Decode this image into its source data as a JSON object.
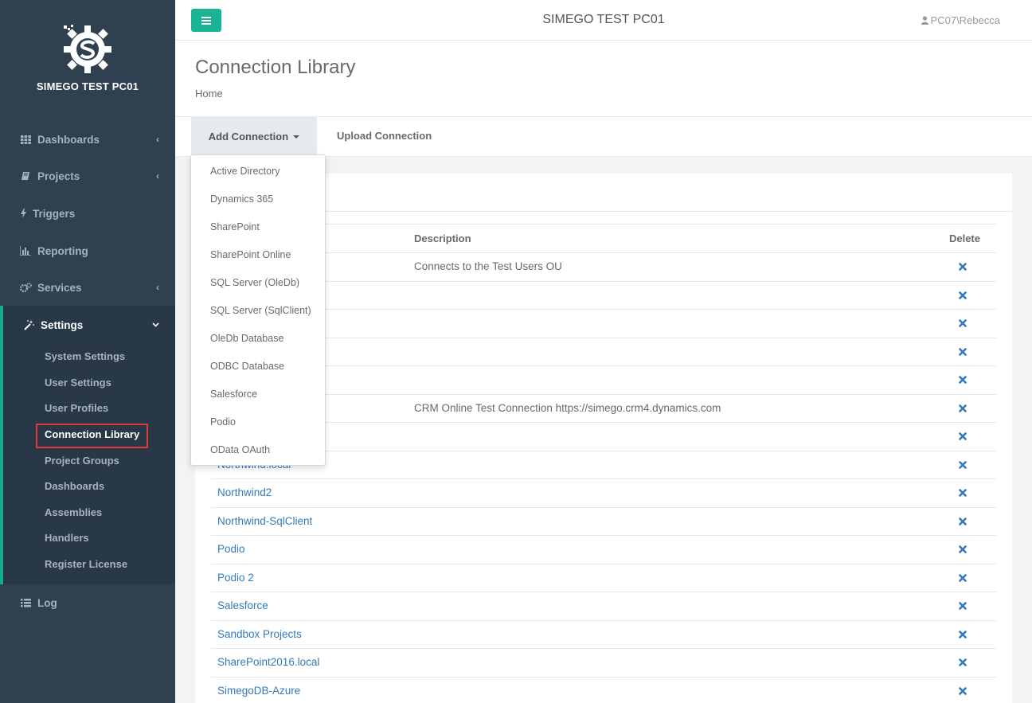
{
  "brand": {
    "name": "SIMEGO TEST PC01"
  },
  "topbar": {
    "title": "SIMEGO TEST PC01",
    "user": "PC07\\Rebecca"
  },
  "sidebar": {
    "items": [
      {
        "label": "Dashboards",
        "icon": "th-icon",
        "has_chevron": true
      },
      {
        "label": "Projects",
        "icon": "book-icon",
        "has_chevron": true
      },
      {
        "label": "Triggers",
        "icon": "bolt-icon",
        "has_chevron": false
      },
      {
        "label": "Reporting",
        "icon": "bar-chart-icon",
        "has_chevron": false
      },
      {
        "label": "Services",
        "icon": "cogs-icon",
        "has_chevron": true
      }
    ],
    "settings": {
      "label": "Settings",
      "icon": "magic-wand-icon",
      "sub_items": [
        "System Settings",
        "User Settings",
        "User Profiles",
        "Connection Library",
        "Project Groups",
        "Dashboards",
        "Assemblies",
        "Handlers",
        "Register License"
      ],
      "active": "Connection Library"
    },
    "log": {
      "label": "Log",
      "icon": "list-icon"
    }
  },
  "page": {
    "title": "Connection Library",
    "breadcrumb": "Home"
  },
  "toolbar": {
    "add_label": "Add Connection",
    "upload_label": "Upload Connection"
  },
  "dropdown": {
    "items": [
      "Active Directory",
      "Dynamics 365",
      "SharePoint",
      "SharePoint Online",
      "SQL Server (OleDb)",
      "SQL Server (SqlClient)",
      "OleDb Database",
      "ODBC Database",
      "Salesforce",
      "Podio",
      "OData OAuth"
    ]
  },
  "table": {
    "headers": {
      "description": "Description",
      "delete": "Delete"
    },
    "rows": [
      {
        "name": "",
        "description": "Connects to the Test Users OU"
      },
      {
        "name": "",
        "description": ""
      },
      {
        "name": "",
        "description": ""
      },
      {
        "name": "",
        "description": ""
      },
      {
        "name": "",
        "description": ""
      },
      {
        "name": "",
        "description": "CRM Online Test Connection https://simego.crm4.dynamics.com"
      },
      {
        "name": "",
        "description": ""
      },
      {
        "name": "Northwind.local",
        "description": ""
      },
      {
        "name": "Northwind2",
        "description": ""
      },
      {
        "name": "Northwind-SqlClient",
        "description": ""
      },
      {
        "name": "Podio",
        "description": ""
      },
      {
        "name": "Podio 2",
        "description": ""
      },
      {
        "name": "Salesforce",
        "description": ""
      },
      {
        "name": "Sandbox Projects",
        "description": ""
      },
      {
        "name": "SharePoint2016.local",
        "description": ""
      },
      {
        "name": "SimegoDB-Azure",
        "description": ""
      }
    ]
  },
  "colors": {
    "sidebar_bg": "#2f4050",
    "accent": "#1ab394",
    "link": "#337ab7",
    "highlight_border": "#e0393e"
  }
}
